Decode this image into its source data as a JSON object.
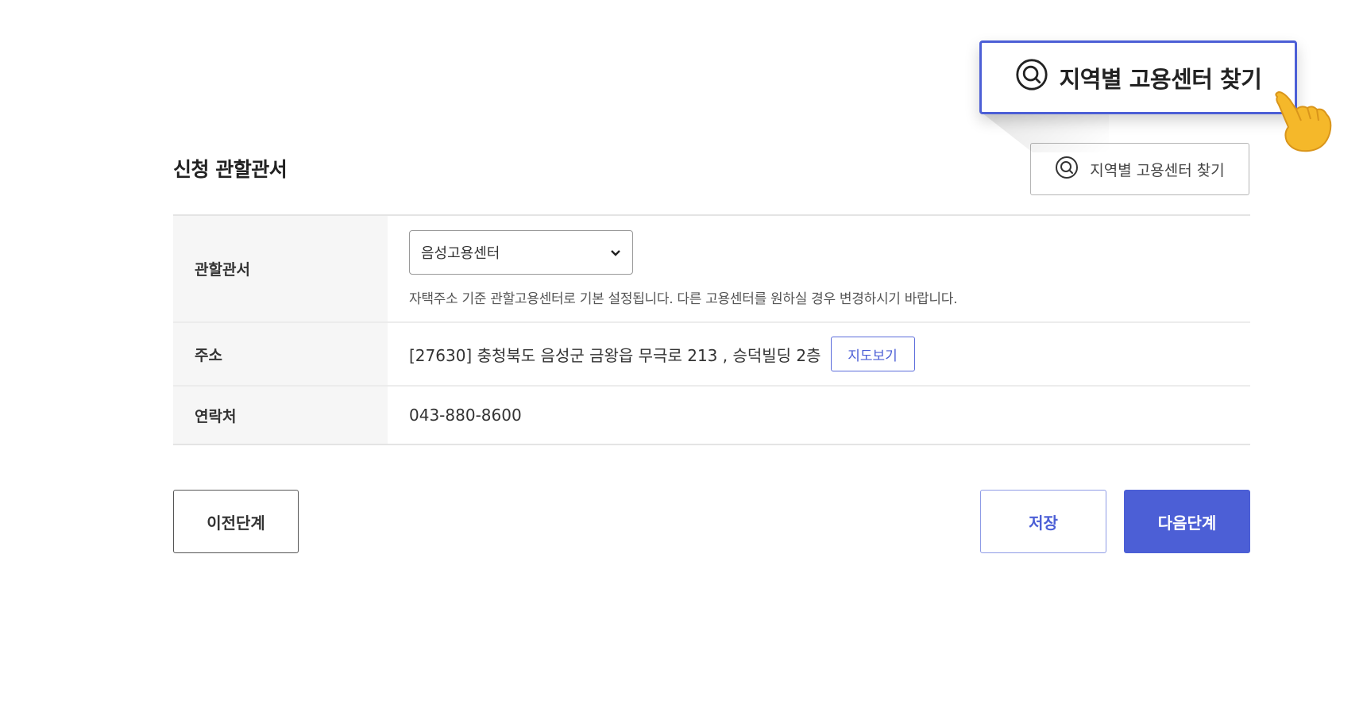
{
  "section": {
    "title": "신청 관할관서"
  },
  "find_button": {
    "label": "지역별 고용센터 찾기"
  },
  "callout": {
    "label": "지역별 고용센터 찾기"
  },
  "table": {
    "office": {
      "label": "관할관서",
      "selected": "음성고용센터",
      "hint": "자택주소 기준 관할고용센터로 기본 설정됩니다. 다른 고용센터를 원하실 경우 변경하시기 바랍니다."
    },
    "address": {
      "label": "주소",
      "value": "[27630] 충청북도 음성군 금왕읍 무극로 213 , 승덕빌딩 2층",
      "map_button": "지도보기"
    },
    "contact": {
      "label": "연락처",
      "value": "043-880-8600"
    }
  },
  "buttons": {
    "prev": "이전단계",
    "save": "저장",
    "next": "다음단계"
  },
  "colors": {
    "accent": "#4c5fd6"
  },
  "icons": {
    "search": "search-icon",
    "pointer": "pointing-hand-icon"
  }
}
